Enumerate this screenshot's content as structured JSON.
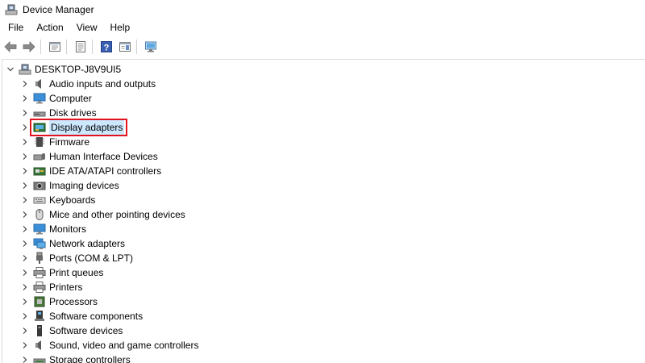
{
  "window": {
    "title": "Device Manager"
  },
  "menu": {
    "items": [
      "File",
      "Action",
      "View",
      "Help"
    ]
  },
  "toolbar": {
    "buttons": [
      "back-arrow-icon",
      "forward-arrow-icon",
      "properties-icon",
      "show-hide-console-tree-icon",
      "help-icon",
      "action-pane-icon",
      "scan-hardware-icon"
    ]
  },
  "tree": {
    "root": "DESKTOP-J8V9UI5",
    "categories": [
      {
        "label": "Audio inputs and outputs",
        "icon": "speaker-icon"
      },
      {
        "label": "Computer",
        "icon": "monitor-icon"
      },
      {
        "label": "Disk drives",
        "icon": "disk-drive-icon"
      },
      {
        "label": "Display adapters",
        "icon": "display-adapter-icon"
      },
      {
        "label": "Firmware",
        "icon": "firmware-chip-icon"
      },
      {
        "label": "Human Interface Devices",
        "icon": "hid-icon"
      },
      {
        "label": "IDE ATA/ATAPI controllers",
        "icon": "ide-controller-icon"
      },
      {
        "label": "Imaging devices",
        "icon": "camera-icon"
      },
      {
        "label": "Keyboards",
        "icon": "keyboard-icon"
      },
      {
        "label": "Mice and other pointing devices",
        "icon": "mouse-icon"
      },
      {
        "label": "Monitors",
        "icon": "monitor-icon"
      },
      {
        "label": "Network adapters",
        "icon": "network-adapter-icon"
      },
      {
        "label": "Ports (COM & LPT)",
        "icon": "port-icon"
      },
      {
        "label": "Print queues",
        "icon": "printer-icon"
      },
      {
        "label": "Printers",
        "icon": "printer-icon"
      },
      {
        "label": "Processors",
        "icon": "processor-icon"
      },
      {
        "label": "Software components",
        "icon": "software-component-icon"
      },
      {
        "label": "Software devices",
        "icon": "software-device-icon"
      },
      {
        "label": "Sound, video and game controllers",
        "icon": "speaker-icon"
      },
      {
        "label": "Storage controllers",
        "icon": "storage-controller-icon"
      }
    ]
  },
  "colors": {
    "highlight_border": "#e0141e",
    "selection_background": "#cce8ff"
  }
}
